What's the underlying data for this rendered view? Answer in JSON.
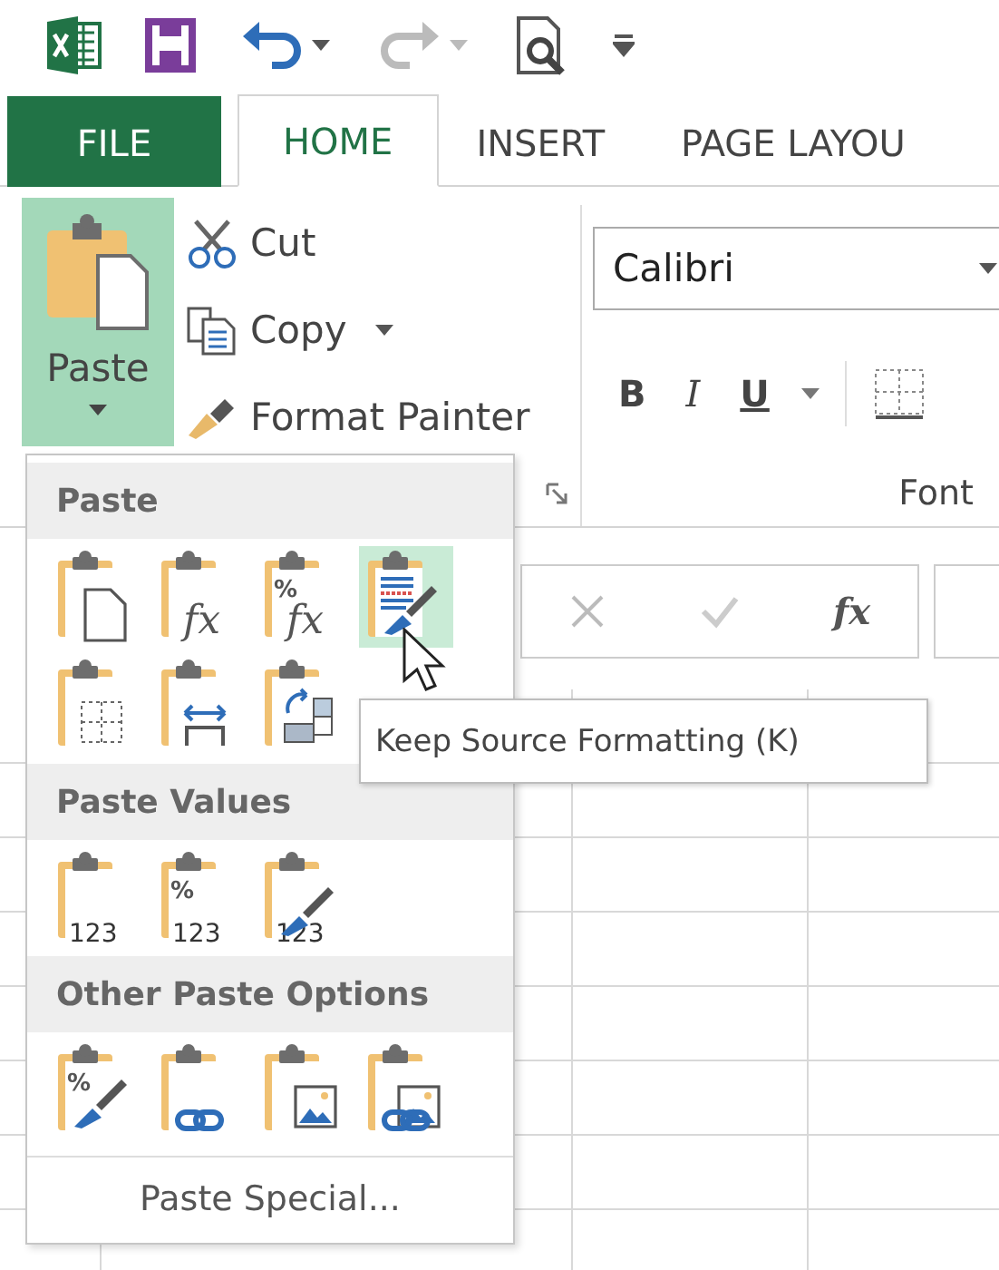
{
  "tabs": [
    {
      "label": "FILE",
      "kind": "file",
      "selected": false
    },
    {
      "label": "HOME",
      "kind": "tab",
      "selected": true
    },
    {
      "label": "INSERT",
      "kind": "tab",
      "selected": false
    },
    {
      "label": "PAGE LAYOU",
      "kind": "tab",
      "selected": false
    }
  ],
  "clipboard": {
    "paste_button": {
      "label": "Paste",
      "pressed": true
    },
    "commands": [
      {
        "label": "Cut",
        "kind": "cut",
        "dropdown": false
      },
      {
        "label": "Copy",
        "kind": "copy",
        "dropdown": true
      },
      {
        "label": "Format Painter",
        "kind": "brush",
        "dropdown": false
      }
    ]
  },
  "font": {
    "name": "Calibri",
    "group_label": "Font",
    "styles": [
      {
        "label": "B",
        "kind": "bold"
      },
      {
        "label": "I",
        "kind": "italic"
      },
      {
        "label": "U",
        "kind": "underline"
      }
    ]
  },
  "formula_bar": {
    "function_label": "fx"
  },
  "paste_menu": {
    "sections": [
      {
        "title": "Paste",
        "items": [
          {
            "kind": "document",
            "selected": false
          },
          {
            "kind": "formula",
            "glyph": "fx",
            "selected": false
          },
          {
            "kind": "formula",
            "top_text": "%",
            "glyph": "fx",
            "selected": false
          },
          {
            "kind": "brush",
            "selected": true
          },
          {
            "kind": "no-borders",
            "selected": false
          },
          {
            "kind": "column-widths",
            "selected": false
          },
          {
            "kind": "transpose",
            "selected": false
          }
        ]
      },
      {
        "title": "Paste Values",
        "items": [
          {
            "kind": "values",
            "bottom_text": "123",
            "selected": false
          },
          {
            "kind": "values",
            "top_text": "%",
            "bottom_text": "123",
            "selected": false
          },
          {
            "kind": "brush-values",
            "bottom_text": "123",
            "selected": false
          }
        ]
      },
      {
        "title": "Other Paste Options",
        "items": [
          {
            "kind": "percent-brush",
            "top_text": "%",
            "selected": false
          },
          {
            "kind": "link",
            "selected": false
          },
          {
            "kind": "picture",
            "selected": false
          },
          {
            "kind": "linked-picture",
            "selected": false
          }
        ]
      }
    ],
    "footer": "Paste Special..."
  },
  "tooltip": "Keep Source Formatting (K)"
}
